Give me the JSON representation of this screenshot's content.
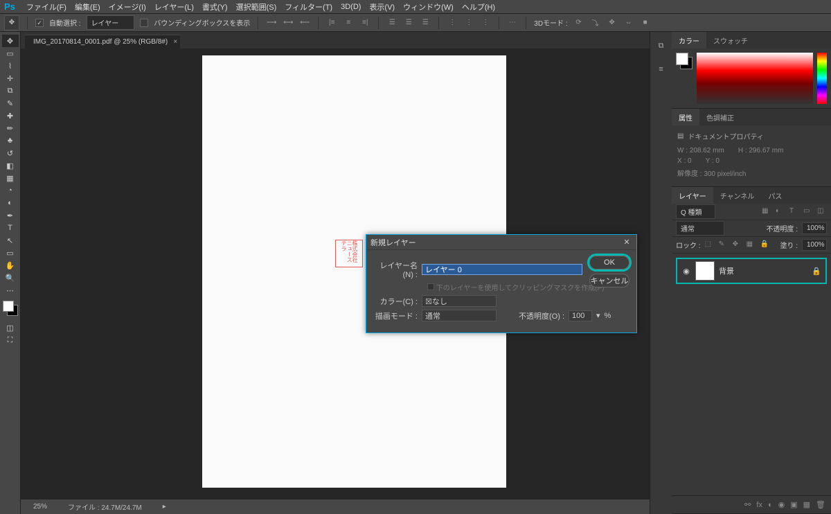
{
  "menubar": {
    "items": [
      "ファイル(F)",
      "編集(E)",
      "イメージ(I)",
      "レイヤー(L)",
      "書式(Y)",
      "選択範囲(S)",
      "フィルター(T)",
      "3D(D)",
      "表示(V)",
      "ウィンドウ(W)",
      "ヘルプ(H)"
    ]
  },
  "optbar": {
    "auto_select": "自動選択 :",
    "layer_dd": "レイヤー",
    "bbox_label": "バウンディングボックスを表示",
    "mode3d": "3Dモード :"
  },
  "tab": {
    "title": "IMG_20170814_0001.pdf @ 25% (RGB/8#)"
  },
  "stamp_text": "株式会社ニューステラ",
  "statusbar": {
    "zoom": "25%",
    "file": "ファイル : 24.7M/24.7M"
  },
  "color_panel": {
    "tabs": [
      "カラー",
      "スウォッチ"
    ]
  },
  "props_panel": {
    "tabs": [
      "属性",
      "色調補正"
    ],
    "doc_prop": "ドキュメントプロパティ",
    "w": "W : 208.62 mm",
    "h": "H : 296.67 mm",
    "x": "X : 0",
    "y": "Y : 0",
    "res": "解像度 : 300 pixel/inch"
  },
  "layers_panel": {
    "tabs": [
      "レイヤー",
      "チャンネル",
      "パス"
    ],
    "kind": "Q 種類",
    "mode": "通常",
    "opacity_label": "不透明度 :",
    "opacity_val": "100%",
    "lock_label": "ロック :",
    "fill_label": "塗り :",
    "fill_val": "100%",
    "layer_name": "背景"
  },
  "dialog": {
    "title": "新規レイヤー",
    "name_label": "レイヤー名(N) :",
    "name_value": "レイヤー 0",
    "clip_label": "下のレイヤーを使用してクリッピングマスクを作成(P)",
    "color_label": "カラー(C) :",
    "color_value": "☒なし",
    "mode_label": "描画モード :",
    "mode_value": "通常",
    "opacity_label": "不透明度(O) :",
    "opacity_value": "100",
    "opacity_unit": "%",
    "ok": "OK",
    "cancel": "キャンセル"
  }
}
